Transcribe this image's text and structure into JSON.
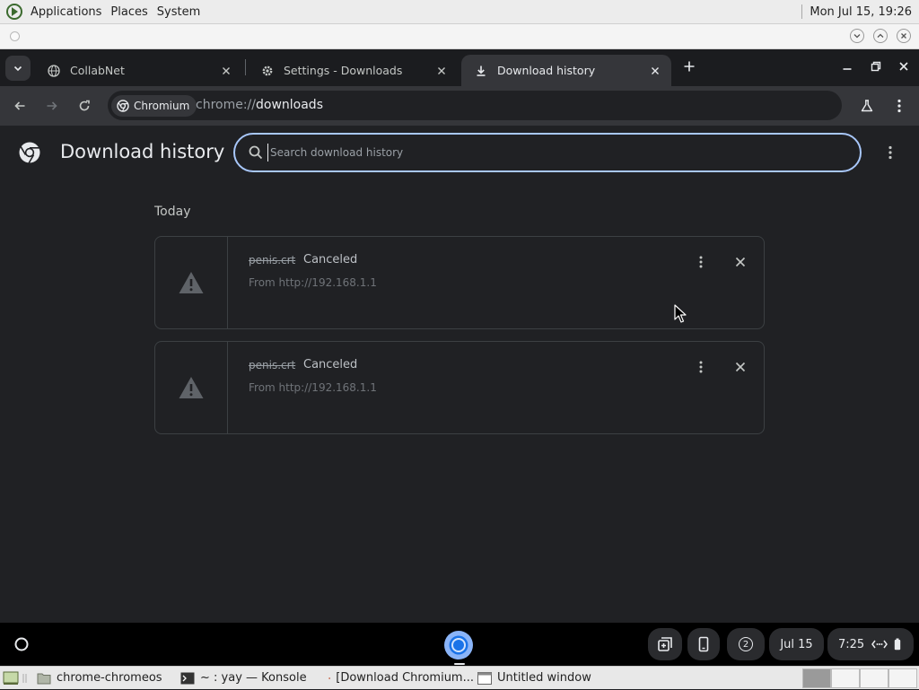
{
  "host": {
    "menus": [
      "Applications",
      "Places",
      "System"
    ],
    "clock": "Mon Jul 15, 19:26"
  },
  "tabs": [
    {
      "title": "CollabNet",
      "icon": "globe-icon",
      "active": false
    },
    {
      "title": "Settings - Downloads",
      "icon": "gear-icon",
      "active": false
    },
    {
      "title": "Download history",
      "icon": "download-icon",
      "active": true
    }
  ],
  "toolbar": {
    "chip_label": "Chromium",
    "url_scheme": "chrome://",
    "url_host": "downloads"
  },
  "page": {
    "title": "Download history",
    "search_placeholder": "Search download history",
    "section_label": "Today",
    "downloads": [
      {
        "file_name": "penis.crt",
        "status": "Canceled",
        "source": "From http://192.168.1.1"
      },
      {
        "file_name": "penis.crt",
        "status": "Canceled",
        "source": "From http://192.168.1.1"
      }
    ]
  },
  "shelf": {
    "notification_count": "2",
    "date": "Jul 15",
    "time": "7:25"
  },
  "taskbar": {
    "items": [
      {
        "label": "chrome-chromeos",
        "icon": "folder-icon"
      },
      {
        "label": "~ : yay — Konsole",
        "icon": "terminal-icon"
      },
      {
        "label": "[Download Chromium...",
        "icon": "firefox-icon"
      },
      {
        "label": "Untitled window",
        "icon": "window-icon"
      }
    ]
  },
  "colors": {
    "page_bg": "#202124",
    "toolbar_bg": "#35363a",
    "focus_ring": "#a8c7fa",
    "shelf_bg": "#000000"
  }
}
